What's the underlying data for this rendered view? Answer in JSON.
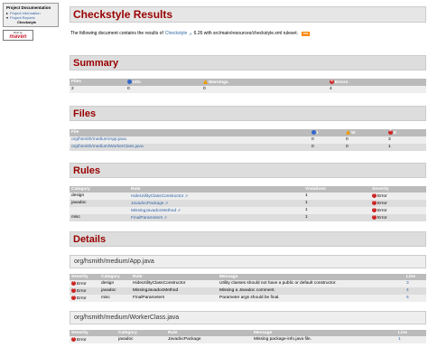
{
  "nav": {
    "title": "Project Documentation",
    "items": [
      "Project Information",
      "Project Reports"
    ],
    "subitem": "Checkstyle",
    "badge_top": "Built by",
    "badge_brand": "maven"
  },
  "header": {
    "title": "Checkstyle Results",
    "intro_prefix": "The following document contains the results of",
    "intro_link": "Checkstyle",
    "intro_suffix": "6.26 with src/main/resources/checkstyle.xml ruleset.",
    "rss_label": "rss"
  },
  "summary": {
    "title": "Summary",
    "headers": [
      "Files",
      "Info",
      "Warnings",
      "Errors"
    ],
    "values": [
      "2",
      "0",
      "0",
      "4"
    ]
  },
  "files": {
    "title": "Files",
    "headers": [
      "File",
      "I",
      "W",
      "E"
    ],
    "rows": [
      [
        "org/hsmith/medium/App.java",
        "0",
        "0",
        "3"
      ],
      [
        "org/hsmith/medium/WorkerClass.java",
        "0",
        "0",
        "1"
      ]
    ]
  },
  "rules": {
    "title": "Rules",
    "headers": [
      "Category",
      "Rule",
      "Violations",
      "Severity"
    ],
    "rows": [
      {
        "category": "design",
        "rule": "HideUtilityClassConstructor",
        "violations": "1",
        "severity": "Error"
      },
      {
        "category": "javadoc",
        "rule": "JavadocPackage",
        "violations": "1",
        "severity": "Error"
      },
      {
        "category": "",
        "rule": "MissingJavadocMethod",
        "violations": "1",
        "severity": "Error"
      },
      {
        "category": "misc",
        "rule": "FinalParameters",
        "violations": "1",
        "severity": "Error"
      }
    ]
  },
  "details": {
    "title": "Details",
    "headers": [
      "Severity",
      "Category",
      "Rule",
      "Message",
      "Line"
    ],
    "files": [
      {
        "name": "org/hsmith/medium/App.java",
        "rows": [
          {
            "severity": "Error",
            "category": "design",
            "rule": "HideUtilityClassConstructor",
            "message": "Utility classes should not have a public or default constructor.",
            "line": "3"
          },
          {
            "severity": "Error",
            "category": "javadoc",
            "rule": "MissingJavadocMethod",
            "message": "Missing a Javadoc comment.",
            "line": "4"
          },
          {
            "severity": "Error",
            "category": "misc",
            "rule": "FinalParameters",
            "message": "Parameter args should be final.",
            "line": "5"
          }
        ]
      },
      {
        "name": "org/hsmith/medium/WorkerClass.java",
        "rows": [
          {
            "severity": "Error",
            "category": "javadoc",
            "rule": "JavadocPackage",
            "message": "Missing package-info.java file.",
            "line": "1"
          }
        ]
      }
    ]
  }
}
